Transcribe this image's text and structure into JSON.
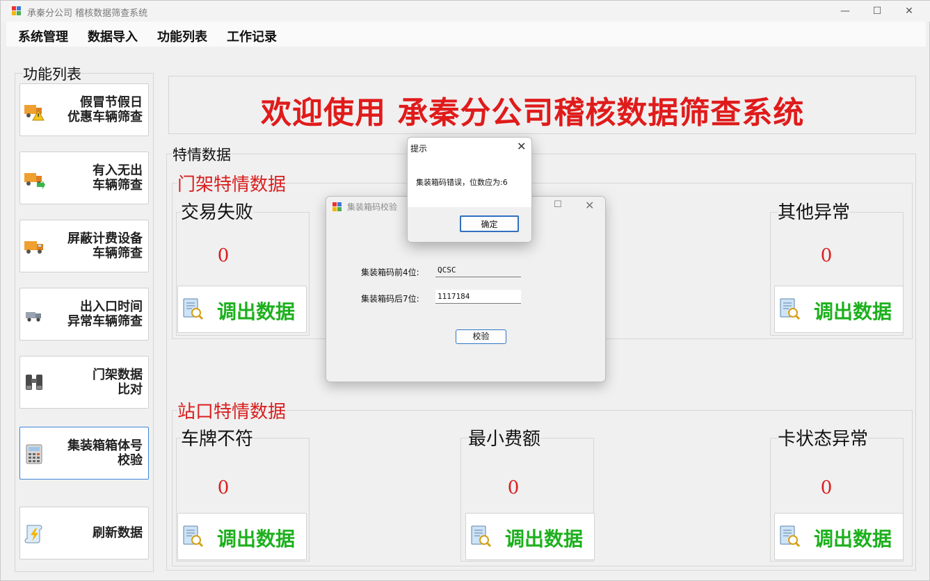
{
  "window": {
    "title": "承秦分公司 稽核数据筛查系统",
    "controls": {
      "minimize": "—",
      "maximize": "☐",
      "close": "✕"
    }
  },
  "menu": {
    "items": [
      "系统管理",
      "数据导入",
      "功能列表",
      "工作记录"
    ]
  },
  "sidebar": {
    "title": "功能列表",
    "buttons": [
      {
        "label": "假冒节假日\n优惠车辆筛查",
        "icon": "truck-warning-icon"
      },
      {
        "label": "有入无出\n车辆筛查",
        "icon": "truck-arrow-icon"
      },
      {
        "label": "屏蔽计费设备\n车辆筛查",
        "icon": "truck-icon"
      },
      {
        "label": "出入口时间\n异常车辆筛查",
        "icon": "truck-small-icon"
      },
      {
        "label": "门架数据\n比对",
        "icon": "binoculars-icon"
      },
      {
        "label": "集装箱箱体号\n校验",
        "icon": "calculator-icon"
      },
      {
        "label": "刷新数据",
        "icon": "scroll-lightning-icon"
      }
    ]
  },
  "main": {
    "welcome": "欢迎使用 承秦分公司稽核数据筛查系统",
    "special_data_title": "特情数据",
    "gantry": {
      "title": "门架特情数据",
      "cards": [
        {
          "title": "交易失败",
          "count": "0",
          "button": "调出数据"
        },
        {
          "title": "其他异常",
          "count": "0",
          "button": "调出数据"
        }
      ]
    },
    "station": {
      "title": "站口特情数据",
      "cards": [
        {
          "title": "车牌不符",
          "count": "0",
          "button": "调出数据"
        },
        {
          "title": "最小费额",
          "count": "0",
          "button": "调出数据"
        },
        {
          "title": "卡状态异常",
          "count": "0",
          "button": "调出数据"
        }
      ]
    }
  },
  "container_dialog": {
    "title": "集装箱码校验",
    "prefix_label": "集装箱码前4位:",
    "prefix_value": "QCSC",
    "suffix_label": "集装箱码后7位:",
    "suffix_value": "1117184",
    "verify_button": "校验"
  },
  "message_box": {
    "title": "提示",
    "message": "集装箱码错误，位数应为:6",
    "ok_button": "确定"
  },
  "colors": {
    "welcome": "#e01b1b",
    "section_title": "#d91f1f",
    "count": "#dd1c1c",
    "fetch_button_text": "#1db01d",
    "focus_border": "#3c86d6"
  }
}
